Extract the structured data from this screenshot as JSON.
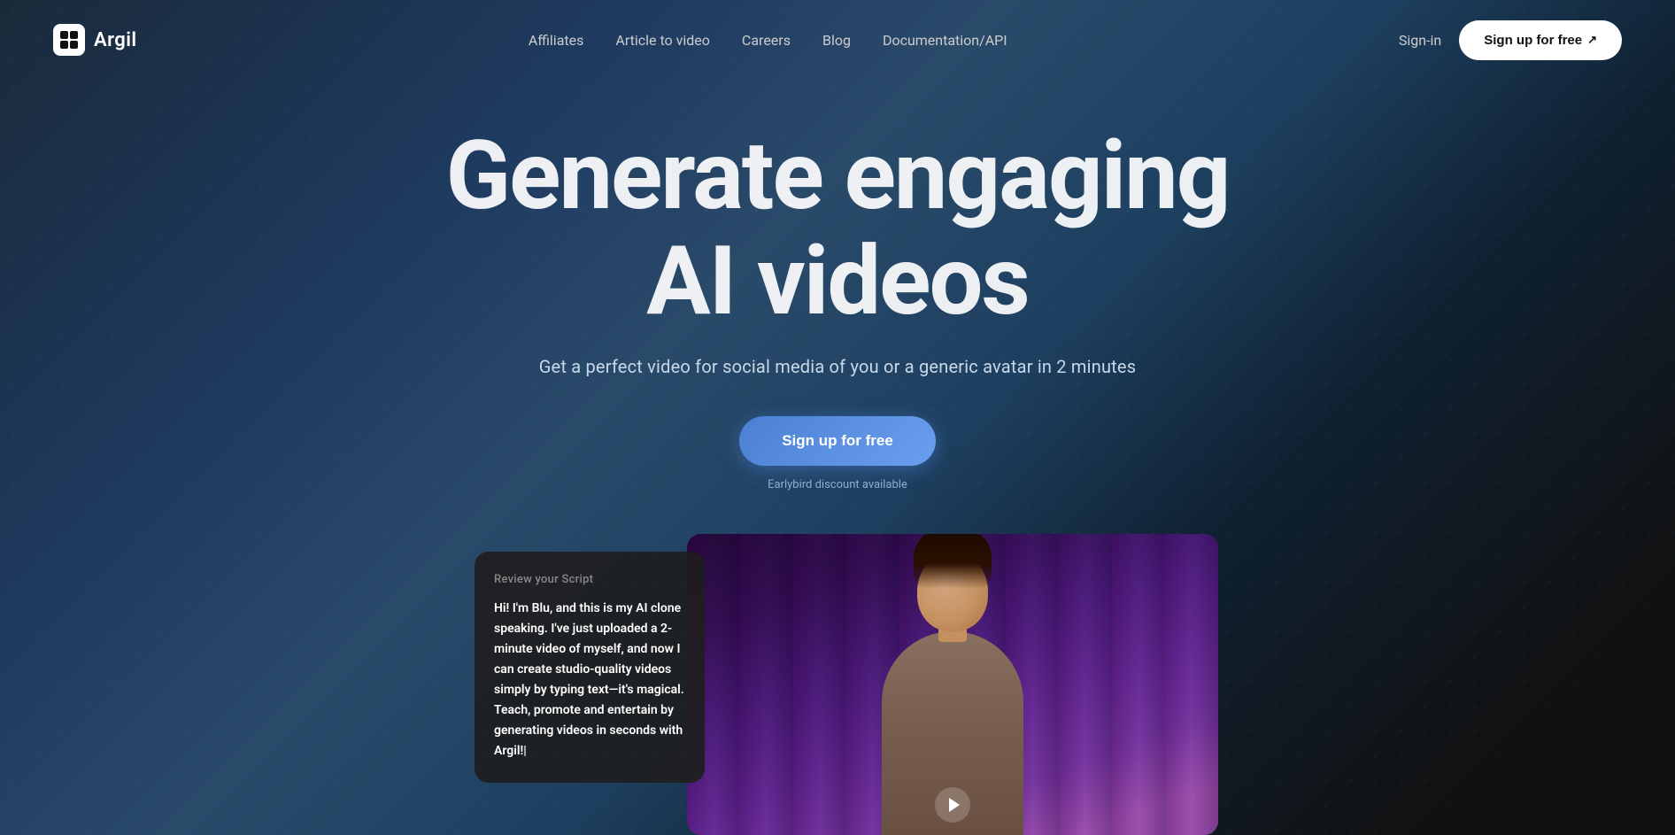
{
  "header": {
    "logo_text": "Argil",
    "nav_items": [
      {
        "label": "Affiliates",
        "id": "affiliates"
      },
      {
        "label": "Article to video",
        "id": "article-to-video"
      },
      {
        "label": "Careers",
        "id": "careers"
      },
      {
        "label": "Blog",
        "id": "blog"
      },
      {
        "label": "Documentation/API",
        "id": "docs"
      }
    ],
    "sign_in_label": "Sign-in",
    "signup_label": "Sign up for free",
    "signup_arrow": "↗"
  },
  "hero": {
    "title_line1": "Generate engaging",
    "title_line2": "AI videos",
    "subtitle": "Get a perfect video for social media of you or a generic avatar in 2 minutes",
    "cta_label": "Sign up for free",
    "earlybird_text": "Earlybird discount available"
  },
  "demo": {
    "script_panel_title": "Review your Script",
    "script_body": "Hi! I'm Blu, and this is my AI clone speaking. I've just uploaded a 2-minute video of myself, and now I can create studio-quality videos simply by typing text—it's magical. Teach, promote and entertain by generating videos in seconds with Argil!|"
  }
}
